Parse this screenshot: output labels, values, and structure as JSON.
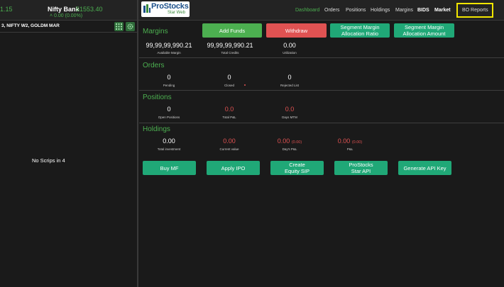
{
  "ticker": {
    "left_partial": "1.15",
    "name": "Nifty Bank",
    "value": "51553.40",
    "change": "0.00 (0.00%)"
  },
  "logo": {
    "title": "ProStocks",
    "subtitle": "Star Web"
  },
  "nav": {
    "dashboard": "Dashboard",
    "orders": "Orders",
    "positions": "Positions",
    "holdings": "Holdings",
    "margins": "Margins",
    "bids": "BIDS",
    "market": "Market",
    "bo_reports": "BO Reports"
  },
  "watchlist": {
    "title": "3, NIFTY W2, GOLDM MAR",
    "empty_text": "No Scrips in 4"
  },
  "margins": {
    "title": "Margins",
    "available_value": "99,99,99,990.21",
    "available_label": "Available Margin",
    "credits_value": "99,99,99,990.21",
    "credits_label": "Total Credits",
    "utilization_value": "0.00",
    "utilization_label": "Utilization",
    "add_funds": "Add Funds",
    "withdraw": "Withdraw",
    "seg_ratio_1": "Segment Margin",
    "seg_ratio_2": "Allocation Ratio",
    "seg_amount_1": "Segment Margin",
    "seg_amount_2": "Allocation Amount"
  },
  "orders": {
    "title": "Orders",
    "pending_value": "0",
    "pending_label": "Pending",
    "closed_value": "0",
    "closed_label": "Closed",
    "rejected_value": "0",
    "rejected_label": "Rejected List"
  },
  "positions": {
    "title": "Positions",
    "open_value": "0",
    "open_label": "Open Positions",
    "pnl_value": "0.0",
    "pnl_label": "Total P&L",
    "mtm_value": "0.0",
    "mtm_label": "Days MTM"
  },
  "holdings": {
    "title": "Holdings",
    "investment_value": "0.00",
    "investment_label": "Total investment",
    "current_value": "0.00",
    "current_label": "Current value",
    "days_pnl_value": "0.00",
    "days_pnl_pct": "(0.00)",
    "days_pnl_label": "Day's P&L",
    "pnl_value": "0.00",
    "pnl_pct": "(0.00)",
    "pnl_label": "P&L"
  },
  "actions": {
    "buy_mf": "Buy MF",
    "apply_ipo": "Apply IPO",
    "equity_sip_1": "Create",
    "equity_sip_2": "Equity SIP",
    "star_api_1": "ProStocks",
    "star_api_2": "Star API",
    "api_key": "Generate API Key"
  },
  "colors": {
    "background": "#1a1a1a",
    "accent_green": "#4caf50",
    "teal_button": "#20a877",
    "withdraw_red": "#e05252",
    "highlight_yellow": "#f2e600"
  }
}
